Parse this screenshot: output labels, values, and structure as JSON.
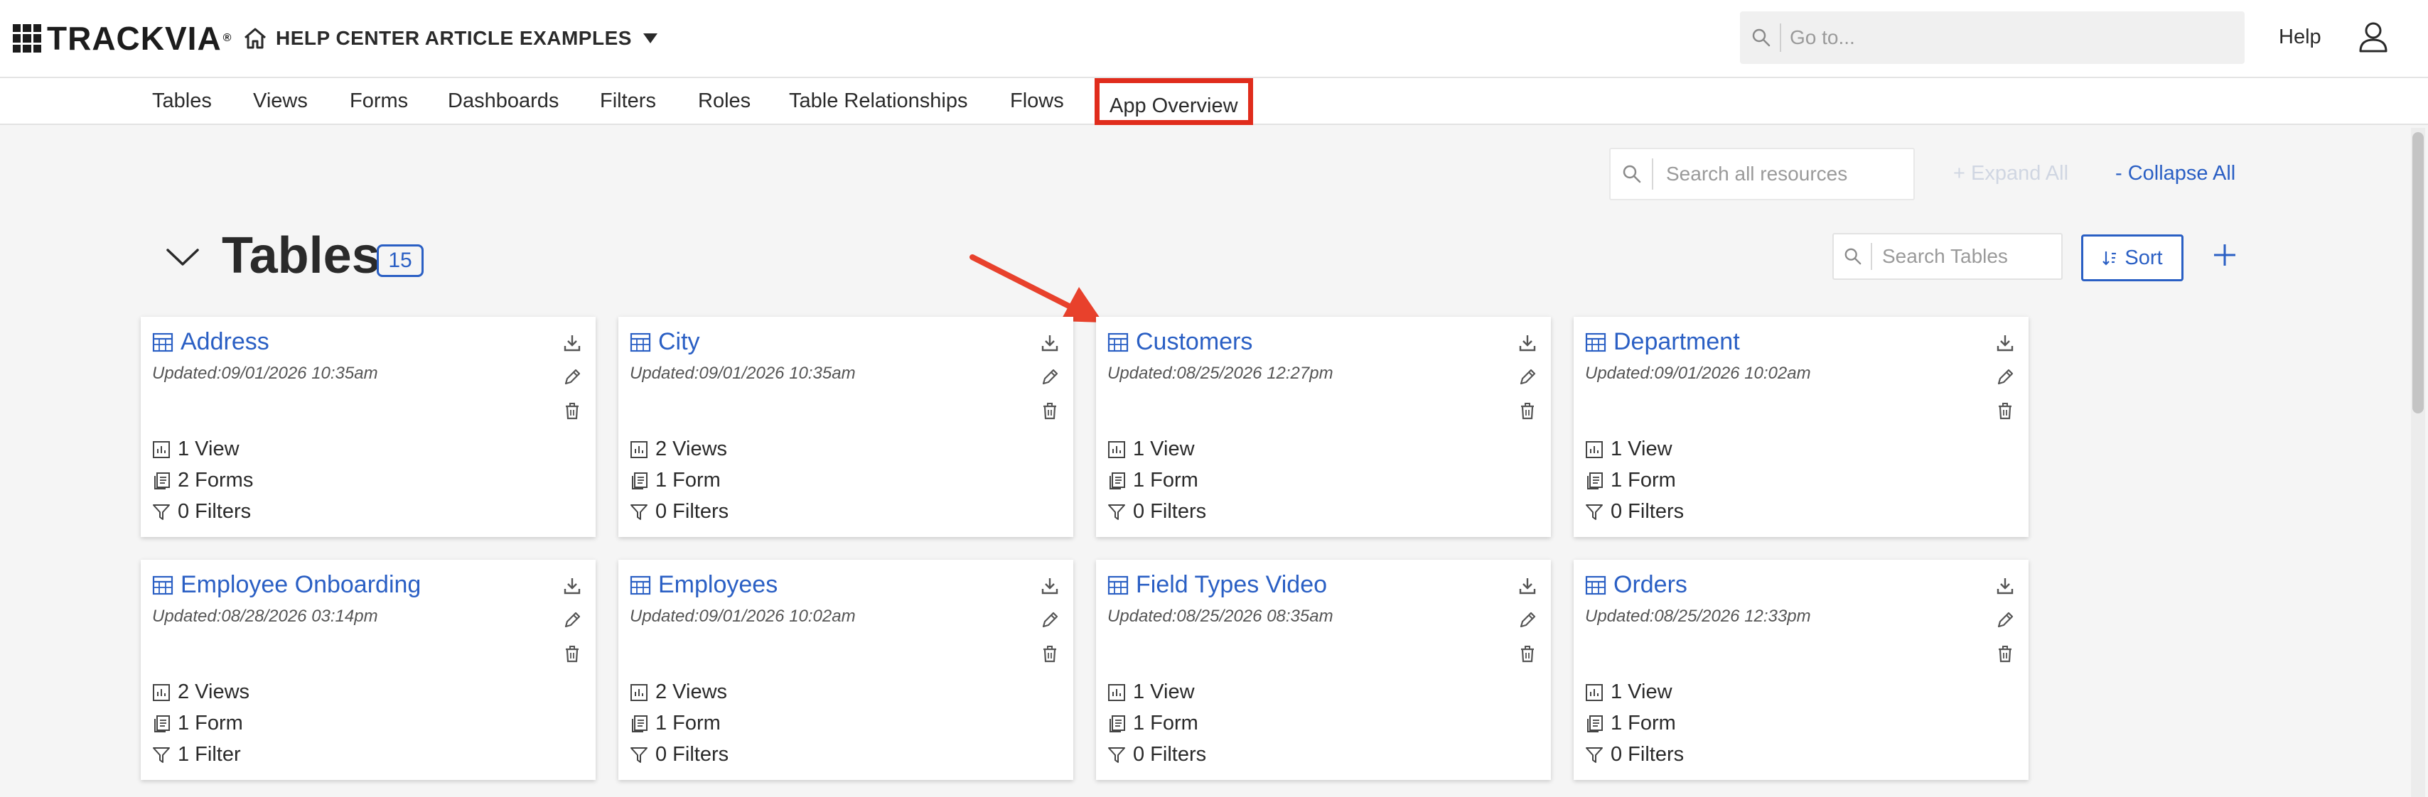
{
  "header": {
    "logo_text": "TRACKVIA",
    "logo_mark": "®",
    "app_title": "HELP CENTER ARTICLE EXAMPLES",
    "goto_placeholder": "Go to...",
    "help_label": "Help"
  },
  "subnav": {
    "items": [
      {
        "label": "Tables"
      },
      {
        "label": "Views"
      },
      {
        "label": "Forms"
      },
      {
        "label": "Dashboards"
      },
      {
        "label": "Filters"
      },
      {
        "label": "Roles"
      },
      {
        "label": "Table Relationships"
      },
      {
        "label": "Flows"
      },
      {
        "label": "App Overview"
      }
    ],
    "highlight_color": "#e02c1c"
  },
  "toolbar": {
    "search_placeholder": "Search all resources",
    "expand_all_label": "+ Expand All",
    "collapse_all_label": "- Collapse All"
  },
  "section": {
    "title": "Tables",
    "count": "15",
    "search_placeholder": "Search Tables",
    "sort_label": "Sort"
  },
  "cards": [
    {
      "name": "Address",
      "updated": "Updated:09/01/2026 10:35am",
      "views": "1 View",
      "forms": "2 Forms",
      "filters": "0 Filters"
    },
    {
      "name": "City",
      "updated": "Updated:09/01/2026 10:35am",
      "views": "2 Views",
      "forms": "1 Form",
      "filters": "0 Filters"
    },
    {
      "name": "Customers",
      "updated": "Updated:08/25/2026 12:27pm",
      "views": "1 View",
      "forms": "1 Form",
      "filters": "0 Filters"
    },
    {
      "name": "Department",
      "updated": "Updated:09/01/2026 10:02am",
      "views": "1 View",
      "forms": "1 Form",
      "filters": "0 Filters"
    },
    {
      "name": "Employee Onboarding",
      "updated": "Updated:08/28/2026 03:14pm",
      "views": "2 Views",
      "forms": "1 Form",
      "filters": "1 Filter"
    },
    {
      "name": "Employees",
      "updated": "Updated:09/01/2026 10:02am",
      "views": "2 Views",
      "forms": "1 Form",
      "filters": "0 Filters"
    },
    {
      "name": "Field Types Video",
      "updated": "Updated:08/25/2026 08:35am",
      "views": "1 View",
      "forms": "1 Form",
      "filters": "0 Filters"
    },
    {
      "name": "Orders",
      "updated": "Updated:08/25/2026 12:33pm",
      "views": "1 View",
      "forms": "1 Form",
      "filters": "0 Filters"
    }
  ],
  "colors": {
    "accent": "#2a5fc4",
    "annotation": "#e02c1c"
  },
  "icons": {
    "table": "table-grid-icon",
    "download": "download-icon",
    "edit": "pencil-icon",
    "delete": "trash-icon",
    "views": "chart-icon",
    "forms": "form-icon",
    "filters": "funnel-icon"
  }
}
